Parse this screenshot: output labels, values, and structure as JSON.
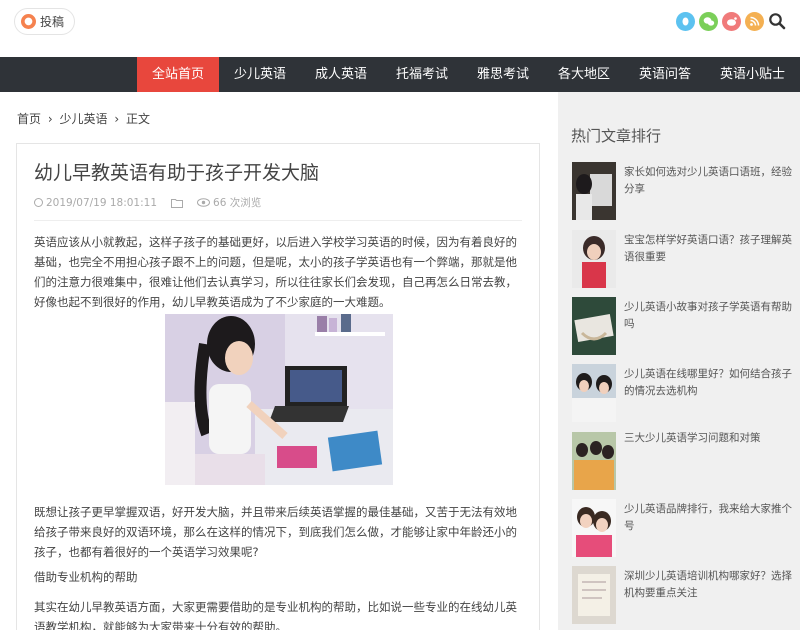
{
  "topbar": {
    "contribute_label": "投稿",
    "contribute_icon": "user-icon",
    "social_icons": [
      "qq-icon",
      "wechat-icon",
      "weibo-icon",
      "rss-icon"
    ],
    "search_icon": "search-icon"
  },
  "nav": {
    "items": [
      "全站首页",
      "少儿英语",
      "成人英语",
      "托福考试",
      "雅思考试",
      "各大地区",
      "英语问答",
      "英语小贴士"
    ],
    "active_color": "#e8473d",
    "bar_color": "#2f3338"
  },
  "breadcrumb": [
    "首页",
    "少儿英语",
    "正文"
  ],
  "breadcrumb_separator": "›",
  "post": {
    "title": "幼儿早教英语有助于孩子开发大脑",
    "date": "2019/07/19 18:01:11",
    "views": "66 次浏览",
    "paragraphs": [
      "英语应该从小就教起，这样子孩子的基础更好，以后进入学校学习英语的时候，因为有着良好的基础，也完全不用担心孩子跟不上的问题，但是呢，太小的孩子学英语也有一个弊端，那就是他们的注意力很难集中，很难让他们去认真学习，所以往往家长们会发现，自己再怎么日常去教，好像也起不到很好的作用，幼儿早教英语成为了不少家庭的一大难题。",
      "既想让孩子更早掌握双语，好开发大脑，并且带来后续英语掌握的最佳基础，又苦于无法有效地给孩子带来良好的双语环境，那么在这样的情况下，到底我们怎么做，才能够让家中年龄还小的孩子，也都有着很好的一个英语学习效果呢?",
      "借助专业机构的帮助",
      "其实在幼儿早教英语方面，大家更需要借助的是专业机构的帮助，比如说一些专业的在线幼儿英语教学机构，就能够为大家带来十分有效的帮助。"
    ]
  },
  "sidebar": {
    "title": "热门文章排行",
    "items": [
      "家长如何选对少儿英语口语班，经验分享",
      "宝宝怎样学好英语口语？孩子理解英语很重要",
      "少儿英语小故事对孩子学英语有帮助吗",
      "少儿英语在线哪里好？如何结合孩子的情况去选机构",
      "三大少儿英语学习问题和对策",
      "少儿英语品牌排行，我来给大家推个号",
      "深圳少儿英语培训机构哪家好？选择机构要重点关注"
    ]
  }
}
